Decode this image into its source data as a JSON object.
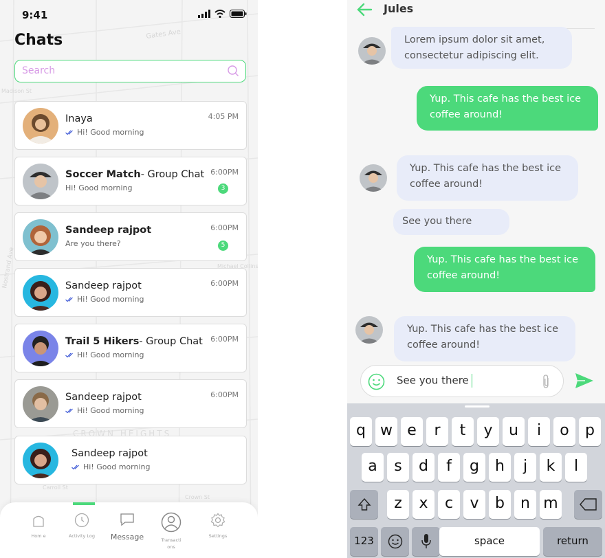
{
  "list_screen": {
    "status": {
      "time": "9:41"
    },
    "title": "Chats",
    "search": {
      "placeholder": "Search"
    },
    "map_labels": [
      "Gates Ave",
      "CROWN HEIGHTS",
      "Nostrand Ave",
      "Madison St",
      "Michael Collins St",
      "Carroll St",
      "Crown St"
    ],
    "chats": [
      {
        "name_bold": "",
        "name": "Inaya",
        "message": "Hi! Good morning",
        "time": "4:05 PM",
        "read_ticks": true,
        "unread": ""
      },
      {
        "name_bold": "Soccer Match",
        "name": "- Group Chat",
        "message": "Hi! Good morning",
        "time": "6:00PM",
        "read_ticks": false,
        "unread": "3"
      },
      {
        "name_bold": "Sandeep rajpot",
        "name": "",
        "message": "Are you there?",
        "time": "6:00PM",
        "read_ticks": false,
        "unread": "5"
      },
      {
        "name_bold": "",
        "name": "Sandeep rajpot",
        "message": "Hi! Good morning",
        "time": "6:00PM",
        "read_ticks": true,
        "unread": ""
      },
      {
        "name_bold": "Trail 5 Hikers",
        "name": "- Group Chat",
        "message": "Hi! Good morning",
        "time": "6:00PM",
        "read_ticks": true,
        "unread": ""
      },
      {
        "name_bold": "",
        "name": "Sandeep rajpot",
        "message": "Hi! Good morning",
        "time": "6:00PM",
        "read_ticks": true,
        "unread": ""
      },
      {
        "name_bold": "",
        "name": "Sandeep rajpot",
        "message": "Hi! Good morning",
        "time": "",
        "read_ticks": true,
        "unread": ""
      }
    ],
    "nav": [
      {
        "icon": "home-icon",
        "label": "Hom e"
      },
      {
        "icon": "clock-icon",
        "label": "Activity Log"
      },
      {
        "icon": "message-icon",
        "label": "Message"
      },
      {
        "icon": "user-circle-icon",
        "label": "Transacti ons"
      },
      {
        "icon": "gear-icon",
        "label": "Settings"
      }
    ],
    "accent": "#4cd97b"
  },
  "chat_screen": {
    "contact": "Jules",
    "messages": [
      {
        "dir": "in",
        "text": "Lorem ipsum dolor sit amet, consectetur adipiscing elit."
      },
      {
        "dir": "out",
        "text": "Yup. This cafe has the best ice coffee around!"
      },
      {
        "dir": "in",
        "text": "Yup. This cafe has the best ice coffee around!"
      },
      {
        "dir": "in",
        "text": "See you there"
      },
      {
        "dir": "out",
        "text": "Yup. This cafe has the best ice coffee around!"
      },
      {
        "dir": "in",
        "text": "Yup. This cafe has the best ice coffee around!"
      }
    ],
    "composer": {
      "value": "See you there"
    },
    "keyboard": {
      "row1": [
        "q",
        "w",
        "e",
        "r",
        "t",
        "y",
        "u",
        "i",
        "o",
        "p"
      ],
      "row2": [
        "a",
        "s",
        "d",
        "f",
        "g",
        "h",
        "j",
        "k",
        "l"
      ],
      "row3": [
        "z",
        "x",
        "c",
        "v",
        "b",
        "n",
        "m"
      ],
      "numbers": "123",
      "space": "space",
      "return": "return"
    },
    "colors": {
      "incoming": "#e8ecf9",
      "outgoing": "#4cd97b"
    }
  }
}
